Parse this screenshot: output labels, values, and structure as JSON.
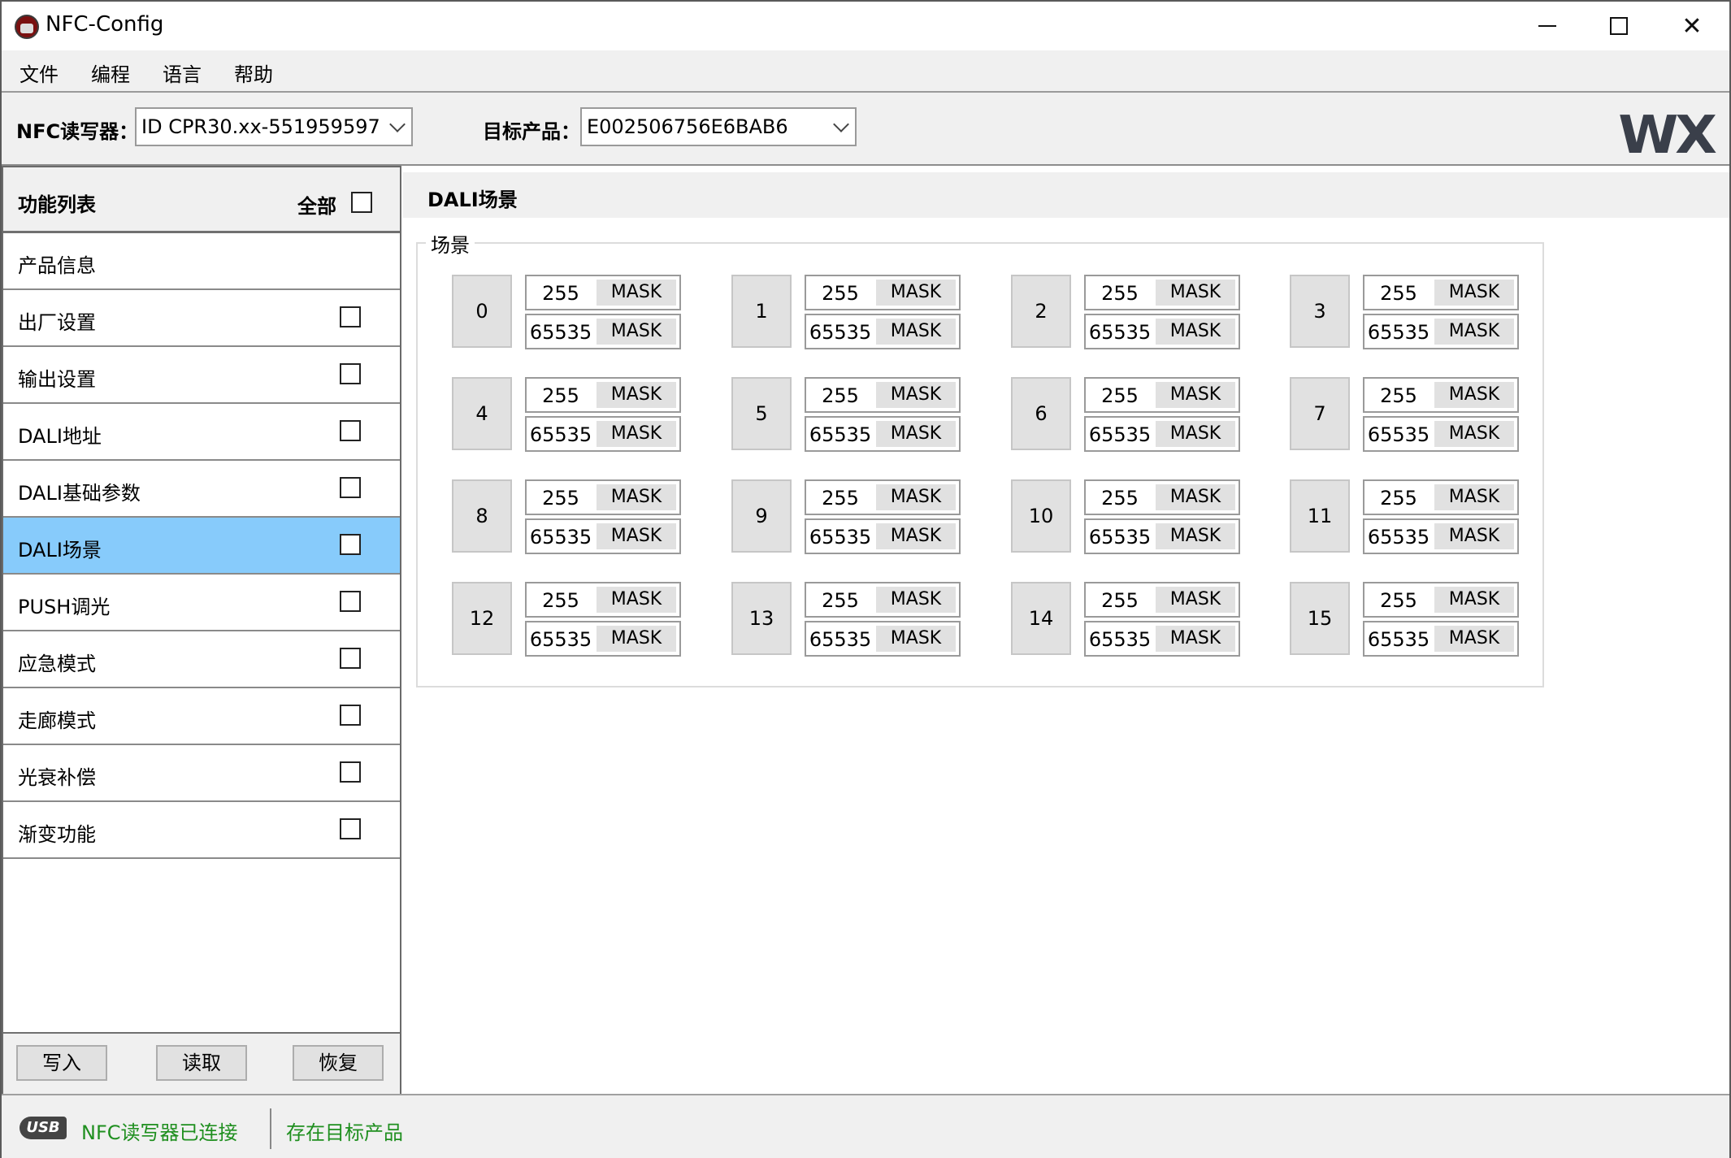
{
  "window": {
    "title": "NFC-Config",
    "controls": {
      "minimize": "minimize-icon",
      "maximize": "maximize-icon",
      "close": "✕"
    }
  },
  "menu": [
    "文件",
    "编程",
    "语言",
    "帮助"
  ],
  "toolbar": {
    "reader_label": "NFC读写器：",
    "reader_value": "ID CPR30.xx-551959597",
    "product_label": "目标产品：",
    "product_value": "E002506756E6BAB6",
    "logo": "WX"
  },
  "sidebar": {
    "title": "功能列表",
    "all_label": "全部",
    "items": [
      {
        "label": "产品信息",
        "has_checkbox": false,
        "active": false
      },
      {
        "label": "出厂设置",
        "has_checkbox": true,
        "active": false
      },
      {
        "label": "输出设置",
        "has_checkbox": true,
        "active": false
      },
      {
        "label": "DALI地址",
        "has_checkbox": true,
        "active": false
      },
      {
        "label": "DALI基础参数",
        "has_checkbox": true,
        "active": false
      },
      {
        "label": "DALI场景",
        "has_checkbox": true,
        "active": true
      },
      {
        "label": "PUSH调光",
        "has_checkbox": true,
        "active": false
      },
      {
        "label": "应急模式",
        "has_checkbox": true,
        "active": false
      },
      {
        "label": "走廊模式",
        "has_checkbox": true,
        "active": false
      },
      {
        "label": "光衰补偿",
        "has_checkbox": true,
        "active": false
      },
      {
        "label": "渐变功能",
        "has_checkbox": true,
        "active": false
      }
    ],
    "buttons": {
      "write": "写入",
      "read": "读取",
      "restore": "恢复"
    }
  },
  "content": {
    "title": "DALI场景",
    "group_label": "场景",
    "mask_label": "MASK",
    "scenes": [
      {
        "id": "0",
        "level": "255",
        "fade": "65535"
      },
      {
        "id": "1",
        "level": "255",
        "fade": "65535"
      },
      {
        "id": "2",
        "level": "255",
        "fade": "65535"
      },
      {
        "id": "3",
        "level": "255",
        "fade": "65535"
      },
      {
        "id": "4",
        "level": "255",
        "fade": "65535"
      },
      {
        "id": "5",
        "level": "255",
        "fade": "65535"
      },
      {
        "id": "6",
        "level": "255",
        "fade": "65535"
      },
      {
        "id": "7",
        "level": "255",
        "fade": "65535"
      },
      {
        "id": "8",
        "level": "255",
        "fade": "65535"
      },
      {
        "id": "9",
        "level": "255",
        "fade": "65535"
      },
      {
        "id": "10",
        "level": "255",
        "fade": "65535"
      },
      {
        "id": "11",
        "level": "255",
        "fade": "65535"
      },
      {
        "id": "12",
        "level": "255",
        "fade": "65535"
      },
      {
        "id": "13",
        "level": "255",
        "fade": "65535"
      },
      {
        "id": "14",
        "level": "255",
        "fade": "65535"
      },
      {
        "id": "15",
        "level": "255",
        "fade": "65535"
      }
    ]
  },
  "status": {
    "usb_icon": "USB",
    "reader_status": "NFC读写器已连接",
    "product_status": "存在目标产品",
    "status_color": "#1f8f1f",
    "active_item_color": "#87cbfb"
  }
}
